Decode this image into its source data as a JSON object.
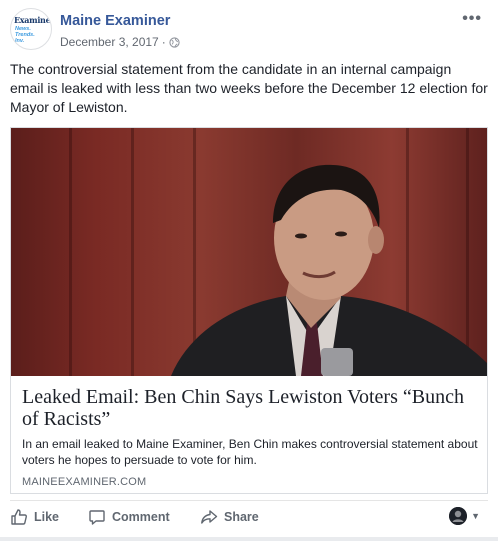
{
  "post": {
    "page_name": "Maine Examiner",
    "date": "December 3, 2017",
    "separator": "·",
    "text": "The controversial statement from the candidate in an internal campaign email is leaked with less than two weeks before the December 12 election for Mayor of Lewiston.",
    "avatar": {
      "logo_text": "Examiner",
      "logo_sub": "News.\nTrends.\nInv."
    }
  },
  "link": {
    "title": "Leaked Email: Ben Chin Says Lewiston Voters “Bunch of Racists”",
    "description": "In an email leaked to Maine Examiner, Ben Chin makes controversial statement about voters he hopes to persuade to vote for him.",
    "domain": "MAINEEXAMINER.COM"
  },
  "actions": {
    "like": "Like",
    "comment": "Comment",
    "share": "Share"
  },
  "icons": {
    "more": "more-options-icon",
    "audience": "globe-icon",
    "like": "thumbs-up-icon",
    "comment": "comment-bubble-icon",
    "share": "share-arrow-icon"
  },
  "colors": {
    "page_name": "#365899",
    "meta_text": "#616770",
    "action_text": "#606770"
  }
}
